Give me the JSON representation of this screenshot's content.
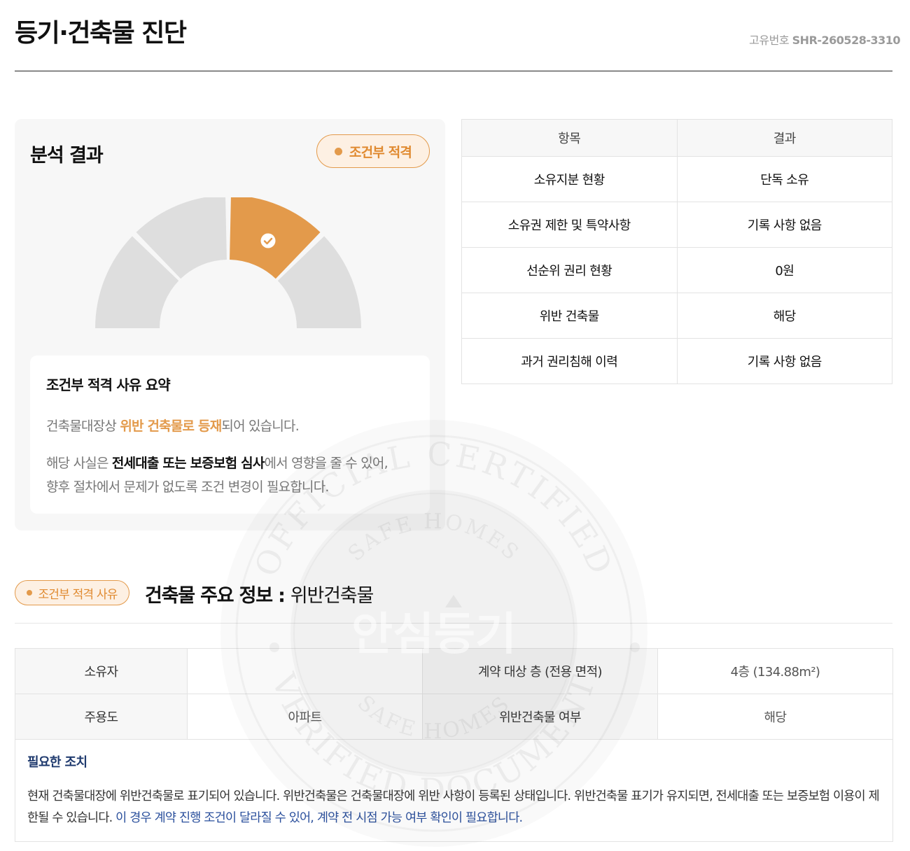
{
  "header": {
    "title": "등기·건축물 진단",
    "id_label": "고유번호",
    "id_value": "SHR-260528-3310"
  },
  "analysis": {
    "title": "분석 결과",
    "verdict": "조건부 적격",
    "gauge": {
      "segments": 4,
      "active_segment": 3,
      "active_color": "#e39a4b",
      "inactive_color": "#dedede",
      "icon": "check-icon"
    },
    "summary": {
      "title": "조건부 적격 사유 요약",
      "line1_pre": "건축물대장상 ",
      "line1_hl": "위반 건축물로 등재",
      "line1_post": "되어 있습니다.",
      "line2_pre": "해당 사실은 ",
      "line2_hl": "전세대출 또는 보증보험 심사",
      "line2_post": "에서 영향을 줄 수 있어,",
      "line3": "향후 절차에서 문제가 없도록 조건 변경이 필요합니다."
    }
  },
  "results_table": {
    "headers": [
      "항목",
      "결과"
    ],
    "rows": [
      [
        "소유지분 현황",
        "단독 소유"
      ],
      [
        "소유권 제한 및 특약사항",
        "기록 사항 없음"
      ],
      [
        "선순위 권리 현황",
        "0원"
      ],
      [
        "위반 건축물",
        "해당"
      ],
      [
        "과거 권리침해 이력",
        "기록 사항 없음"
      ]
    ]
  },
  "building": {
    "badge": "조건부 적격 사유",
    "title_bold": "건축물 주요 정보 : ",
    "title_light": "위반건축물",
    "owner_label": "소유자",
    "owner_value": "",
    "floor_label": "계약 대상 층 (전용 면적)",
    "floor_value": "4층 (134.88m²)",
    "use_label": "주용도",
    "use_value": "아파트",
    "violation_label": "위반건축물 여부",
    "violation_value": "해당",
    "action_title": "필요한 조치",
    "action_text1": "현재 건축물대장에 위반건축물로 표기되어 있습니다. 위반건축물은 건축물대장에 위반 사항이 등록된 상태입니다. 위반건축물 표기가 유지되면, 전세대출 또는 보증보험 이용이 제한될 수 있습니다. ",
    "action_text2": "이 경우 계약 진행 조건이 달라질 수 있어, 계약 전 시점 가능 여부 확인이 필요합니다."
  },
  "watermark": {
    "outer_top": "OFFICIAL CERTIFIED",
    "outer_bottom": "VERIFIED DOCUMENT",
    "inner_top": "SAFE HOMES",
    "inner_bottom": "SAFE HOMES",
    "center": "안심등기"
  }
}
